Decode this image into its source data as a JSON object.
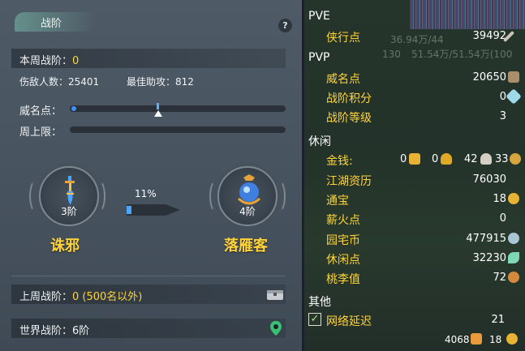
{
  "battle_rank": {
    "title": "战阶",
    "help_label": "?",
    "weekly_rank_label": "本周战阶：",
    "weekly_rank_value": "0",
    "enemies_label": "伤敌人数：",
    "enemies_value": "25401",
    "best_assist_label": "最佳助攻：",
    "best_assist_value": "812",
    "prestige_label": "威名点：",
    "prestige_fraction": 0.0,
    "weekly_cap_label": "周上限：",
    "current_tier": {
      "rank": "3阶",
      "name": "诛邪"
    },
    "next_tier": {
      "rank": "4阶",
      "name": "落雁客"
    },
    "progress_percent": "11%",
    "progress_fraction": 0.11,
    "last_week_label": "上周战阶：",
    "last_week_value": "0 (500名以外)",
    "world_rank_label": "世界战阶：",
    "world_rank_value": "6阶"
  },
  "stats": {
    "pve": {
      "header": "PVE",
      "items": [
        {
          "label": "侠行点",
          "value": "39492",
          "icon": "sword-icon",
          "icon_color": "#c9c3b5"
        }
      ]
    },
    "pvp": {
      "header": "PVP",
      "items": [
        {
          "label": "威名点",
          "value": "20650",
          "icon": "prestige-icon",
          "icon_color": "#a88f6a"
        },
        {
          "label": "战阶积分",
          "value": "0",
          "icon": "crystal-icon",
          "icon_color": "#9fd8e8"
        },
        {
          "label": "战阶等级",
          "value": "3"
        }
      ]
    },
    "leisure": {
      "header": "休闲",
      "money_label": "金钱:",
      "money_values": [
        "0",
        "0",
        "42",
        "33"
      ],
      "items": [
        {
          "label": "江湖资历",
          "value": "76030"
        },
        {
          "label": "通宝",
          "value": "18",
          "icon": "coin-icon",
          "icon_color": "#e8b235"
        },
        {
          "label": "薪火点",
          "value": "0"
        },
        {
          "label": "园宅币",
          "value": "477915",
          "icon": "house-coin-icon",
          "icon_color": "#a9c6d4"
        },
        {
          "label": "休闲点",
          "value": "32230",
          "icon": "leaf-icon",
          "icon_color": "#7ed7b7"
        },
        {
          "label": "桃李值",
          "value": "72",
          "icon": "gourd-icon",
          "icon_color": "#d38a3c"
        }
      ]
    },
    "other": {
      "header": "其他",
      "items": [
        {
          "label": "网络延迟",
          "value": "21",
          "checked": true
        }
      ]
    },
    "footer": {
      "left_value": "4068",
      "right_value": "18"
    },
    "background_ghost": [
      "36.94万/44",
      "130",
      "51.54万/51.54万(100"
    ]
  },
  "colors": {
    "accent_yellow": "#ffd43a",
    "progress_blue": "#4aa6ff",
    "panel_gray": "#4e5a66"
  }
}
